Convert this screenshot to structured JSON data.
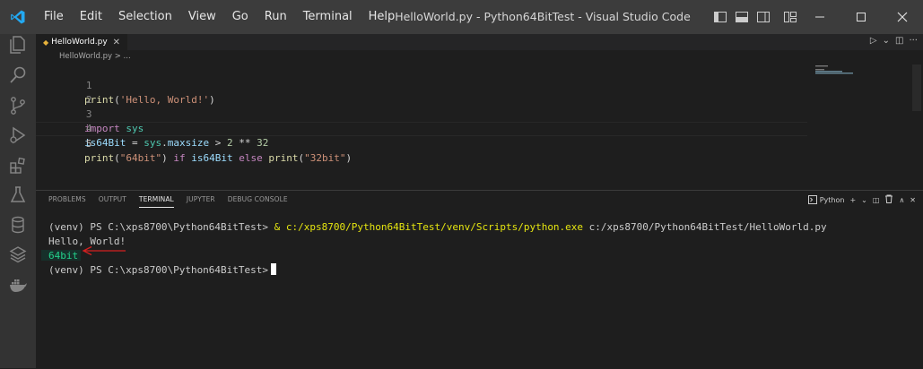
{
  "titlebar": {
    "menu": [
      "File",
      "Edit",
      "Selection",
      "View",
      "Go",
      "Run",
      "Terminal",
      "Help"
    ],
    "window_title": "HelloWorld.py - Python64BitTest - Visual Studio Code"
  },
  "activity_bar": {
    "icons": [
      "explorer-icon",
      "search-icon",
      "source-control-icon",
      "run-debug-icon",
      "extensions-icon",
      "testing-icon",
      "database-icon",
      "layers-icon",
      "docker-icon"
    ]
  },
  "editor": {
    "tab_label": "HelloWorld.py",
    "breadcrumb": "HelloWorld.py  >  ...",
    "lines": [
      {
        "num": "1"
      },
      {
        "num": "2"
      },
      {
        "num": "3"
      },
      {
        "num": "4"
      },
      {
        "num": "5"
      }
    ]
  },
  "panel": {
    "tabs": [
      "PROBLEMS",
      "OUTPUT",
      "TERMINAL",
      "JUPYTER",
      "DEBUG CONSOLE"
    ],
    "active_tab": "TERMINAL",
    "terminal_name": "Python",
    "terminal": {
      "prompt1": "(venv) PS C:\\xps8700\\Python64BitTest> ",
      "cmd_amp": "& ",
      "cmd_exe": "c:/xps8700/Python64BitTest/venv/Scripts/python.exe",
      "cmd_arg": " c:/xps8700/Python64BitTest/HelloWorld.py",
      "out1": "Hello, World!",
      "out2": "64bit",
      "prompt2": "(venv) PS C:\\xps8700\\Python64BitTest>"
    }
  },
  "colors": {
    "accent": "#007acc",
    "arrow": "#d32020",
    "terminal_yellow": "#e5e510",
    "terminal_green": "#23d18b"
  }
}
